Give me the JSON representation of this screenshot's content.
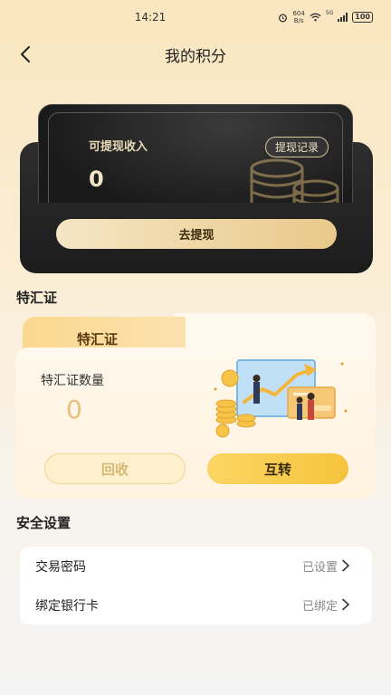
{
  "status_bar": {
    "time": "14:21",
    "net_speed_value": "604",
    "net_speed_unit": "B/s",
    "network_type": "5G",
    "battery": "100"
  },
  "nav": {
    "title": "我的积分"
  },
  "wallet": {
    "income_label": "可提现收入",
    "income_value": "0",
    "record_button": "提现记录",
    "withdraw_button": "去提现"
  },
  "certificate": {
    "section_title": "特汇证",
    "tab_label": "特汇证",
    "count_label": "特汇证数量",
    "count_value": "0",
    "recycle_button": "回收",
    "transfer_button": "互转"
  },
  "security": {
    "section_title": "安全设置",
    "rows": [
      {
        "label": "交易密码",
        "value": "已设置"
      },
      {
        "label": "绑定银行卡",
        "value": "已绑定"
      }
    ]
  },
  "colors": {
    "accent_gold": "#f5c43c",
    "card_dark": "#1c1c1c",
    "tab_gold": "#fbd890"
  }
}
